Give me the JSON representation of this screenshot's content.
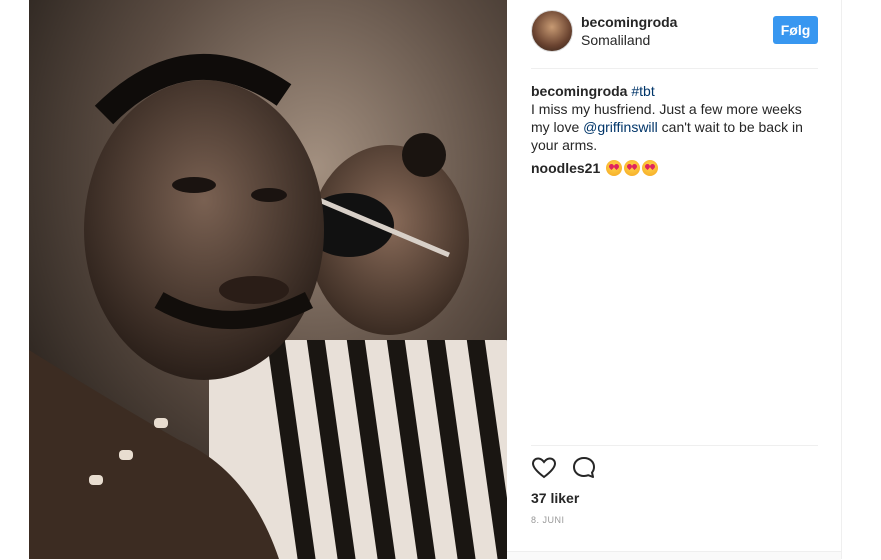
{
  "post": {
    "username": "becomingroda",
    "location": "Somaliland",
    "follow_label": "Følg",
    "caption_user": "becomingroda",
    "caption_hashtag": "#tbt",
    "caption_text_1": "I miss my husfriend. Just a few more weeks my love",
    "caption_mention": "@griffinswill",
    "caption_text_2": "can't wait to be back in your arms.",
    "comment_user": "noodles21",
    "comment_emojis": [
      "heart-eyes-emoji",
      "heart-eyes-emoji",
      "heart-eyes-emoji"
    ],
    "likes": "37 liker",
    "date": "8. JUNI"
  },
  "icons": {
    "like": "heart-outline-icon",
    "comment": "speech-bubble-icon"
  },
  "colors": {
    "follow_bg": "#3897f0",
    "link": "#003569"
  }
}
